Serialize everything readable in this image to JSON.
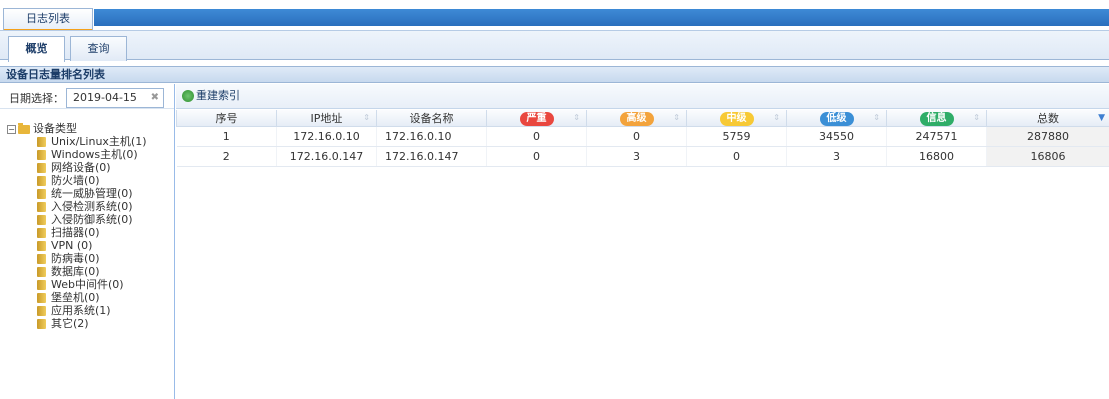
{
  "top_tab": {
    "label": "日志列表"
  },
  "sub_tabs": [
    {
      "label": "概览",
      "active": true
    },
    {
      "label": "查询",
      "active": false
    }
  ],
  "panel": {
    "title": "设备日志量排名列表"
  },
  "date_filter": {
    "label": "日期选择：",
    "value": "2019-04-15",
    "clear_icon": "close-icon"
  },
  "toolbar": {
    "rebuild_label": "重建索引",
    "rebuild_icon": "refresh-icon"
  },
  "tree": {
    "root_label": "设备类型",
    "items": [
      {
        "label": "Unix/Linux主机(1)"
      },
      {
        "label": "Windows主机(0)"
      },
      {
        "label": "网络设备(0)"
      },
      {
        "label": "防火墙(0)"
      },
      {
        "label": "统一威胁管理(0)"
      },
      {
        "label": "入侵检测系统(0)"
      },
      {
        "label": "入侵防御系统(0)"
      },
      {
        "label": "扫描器(0)"
      },
      {
        "label": "VPN (0)"
      },
      {
        "label": "防病毒(0)"
      },
      {
        "label": "数据库(0)"
      },
      {
        "label": "Web中间件(0)"
      },
      {
        "label": "堡垒机(0)"
      },
      {
        "label": "应用系统(1)"
      },
      {
        "label": "其它(2)"
      }
    ]
  },
  "table": {
    "headers": {
      "index": "序号",
      "ip": "IP地址",
      "name": "设备名称",
      "critical": "严重",
      "high": "高级",
      "medium": "中级",
      "low": "低级",
      "info": "信息",
      "total": "总数"
    },
    "level_colors": {
      "critical": "#e9473f",
      "high": "#f3a33c",
      "medium": "#f7c935",
      "low": "#3b8fd6",
      "info": "#2fad68"
    },
    "rows": [
      {
        "index": "1",
        "ip": "172.16.0.10",
        "name": "172.16.0.10",
        "critical": "0",
        "high": "0",
        "medium": "5759",
        "low": "34550",
        "info": "247571",
        "total": "287880"
      },
      {
        "index": "2",
        "ip": "172.16.0.147",
        "name": "172.16.0.147",
        "critical": "0",
        "high": "3",
        "medium": "0",
        "low": "3",
        "info": "16800",
        "total": "16806"
      }
    ]
  }
}
